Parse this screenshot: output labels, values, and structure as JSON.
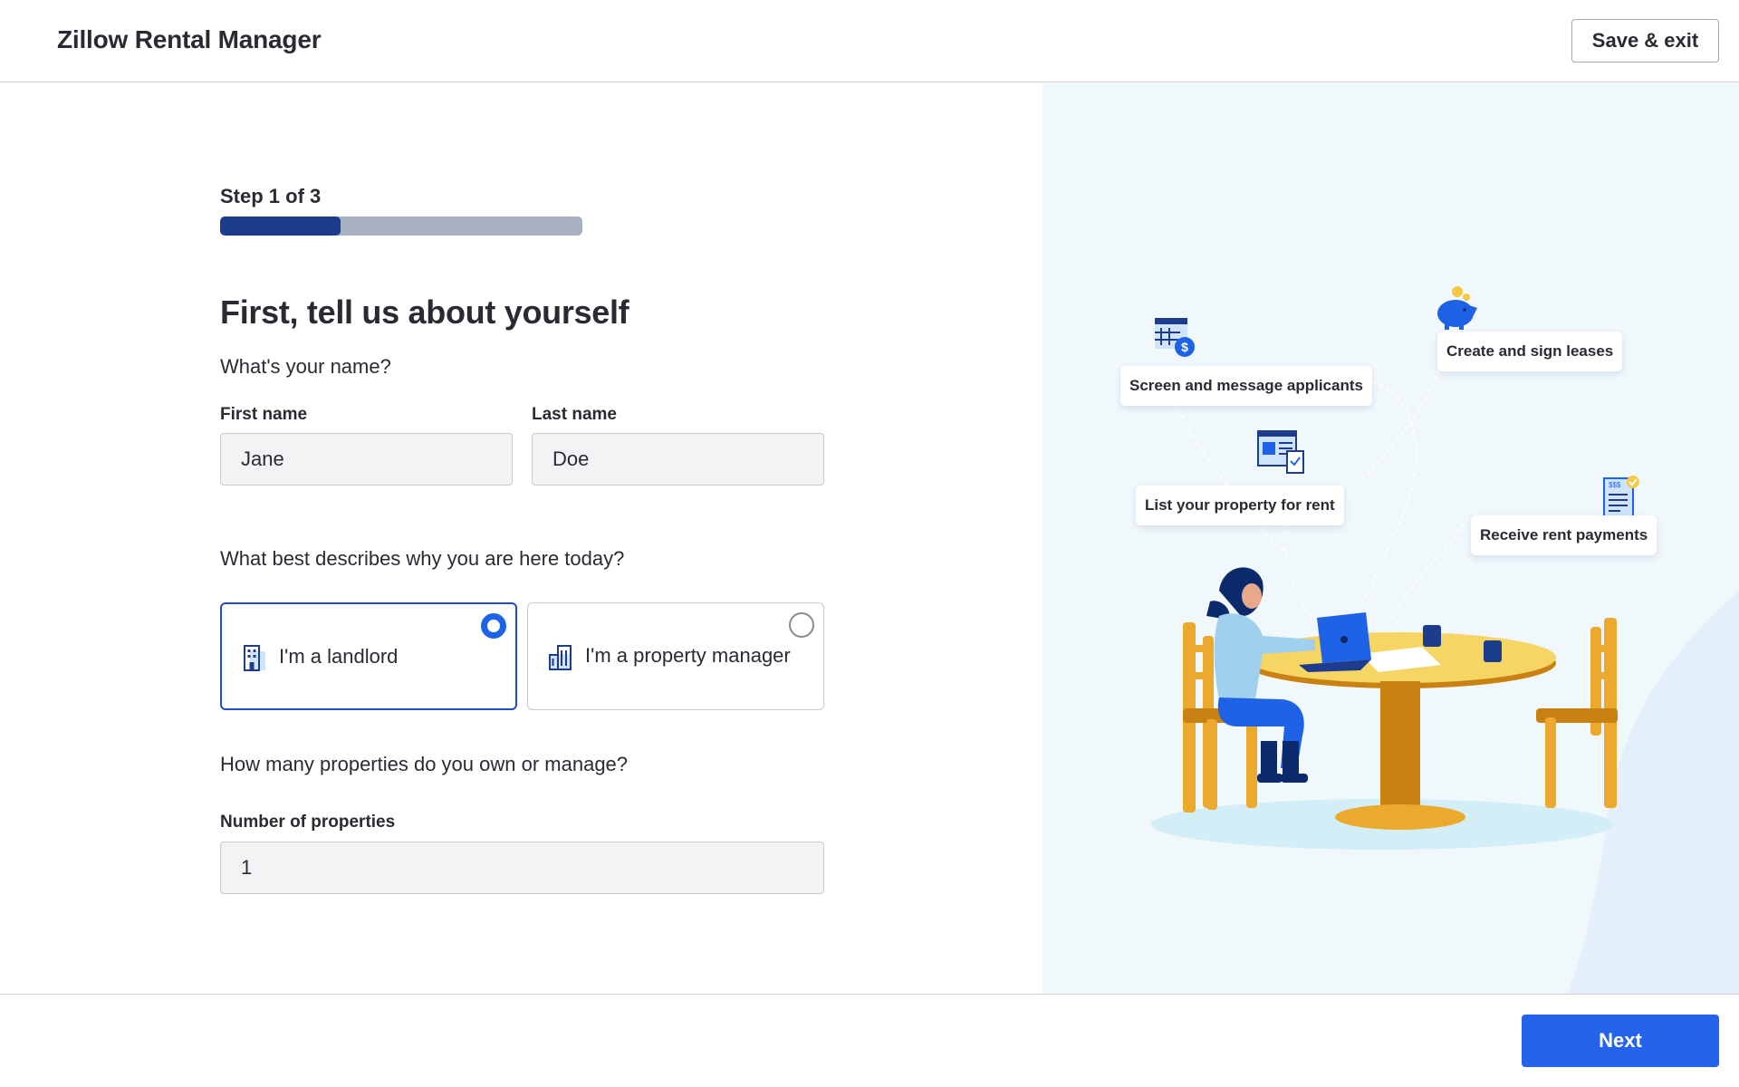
{
  "header": {
    "brand": "Zillow Rental Manager",
    "save_exit_label": "Save & exit"
  },
  "form": {
    "step_label": "Step 1 of 3",
    "progress_fraction": 0.333,
    "heading": "First, tell us about yourself",
    "name_question": "What's your name?",
    "first_name": {
      "label": "First name",
      "value": "Jane"
    },
    "last_name": {
      "label": "Last name",
      "value": "Doe"
    },
    "role_question": "What best describes why you are here today?",
    "roles": [
      {
        "label": "I'm a landlord",
        "selected": true,
        "icon": "building-icon"
      },
      {
        "label": "I'm a property manager",
        "selected": false,
        "icon": "buildings-icon"
      }
    ],
    "count_question": "How many properties do you own or manage?",
    "properties": {
      "label": "Number of properties",
      "value": "1"
    }
  },
  "illustration": {
    "features": [
      {
        "label": "Screen and message applicants",
        "icon": "calendar-dollar-icon"
      },
      {
        "label": "Create and sign leases",
        "icon": "piggy-bank-icon"
      },
      {
        "label": "List your property for rent",
        "icon": "listing-icon"
      },
      {
        "label": "Receive rent payments",
        "icon": "invoice-icon"
      }
    ]
  },
  "footer": {
    "next_label": "Next"
  },
  "colors": {
    "primary": "#2563eb",
    "selected_border": "#1e4ec4",
    "progress_fill": "#1e3c8c",
    "progress_track": "#a7b1c2",
    "side_bg": "#f1f8fc"
  }
}
